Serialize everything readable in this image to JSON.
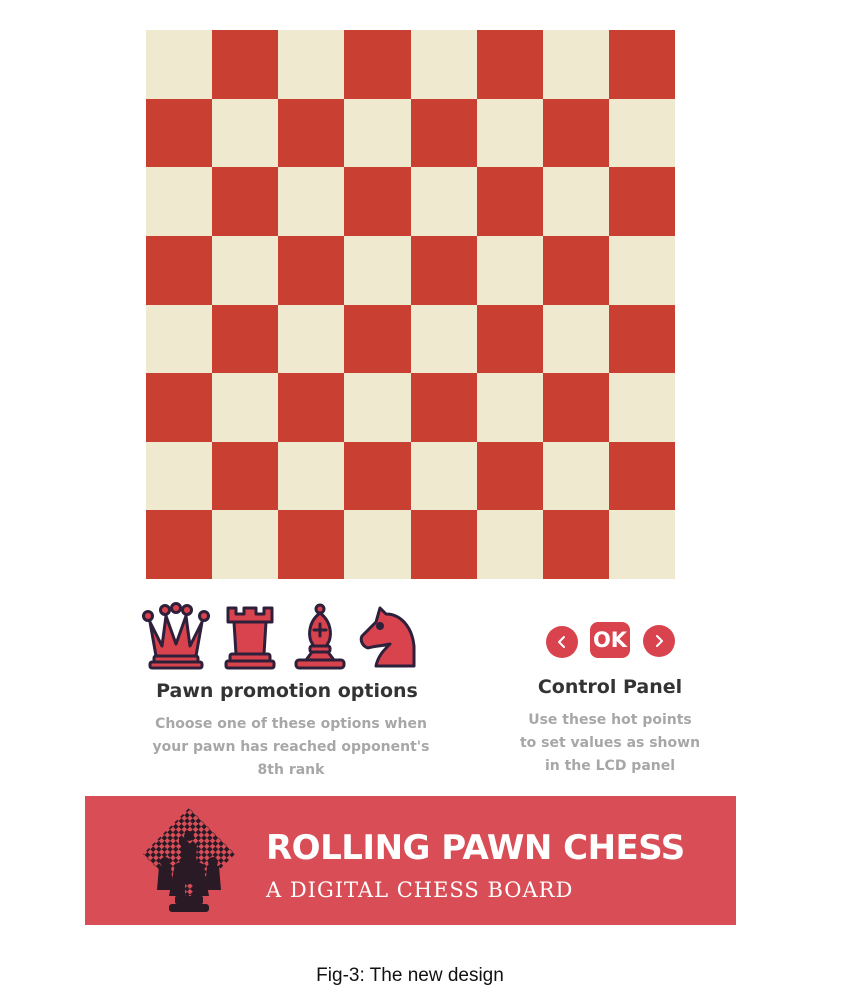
{
  "board": {
    "dark_color": "#c94032",
    "light_color": "#efe9cf"
  },
  "promotion": {
    "pieces": [
      "queen-icon",
      "rook-icon",
      "bishop-icon",
      "knight-icon"
    ],
    "title": "Pawn promotion options",
    "description": "Choose one of these options when\nyour pawn has reached opponent's\n8th rank"
  },
  "control_panel": {
    "prev_icon": "chevron-left-icon",
    "ok_label": "OK",
    "next_icon": "chevron-right-icon",
    "title": "Control Panel",
    "description": "Use these hot points\nto set values as shown\nin the LCD panel"
  },
  "banner": {
    "title": "ROLLING PAWN CHESS",
    "subtitle": "A DIGITAL CHESS BOARD",
    "background": "#d94e56"
  },
  "caption": "Fig-3: The new design"
}
